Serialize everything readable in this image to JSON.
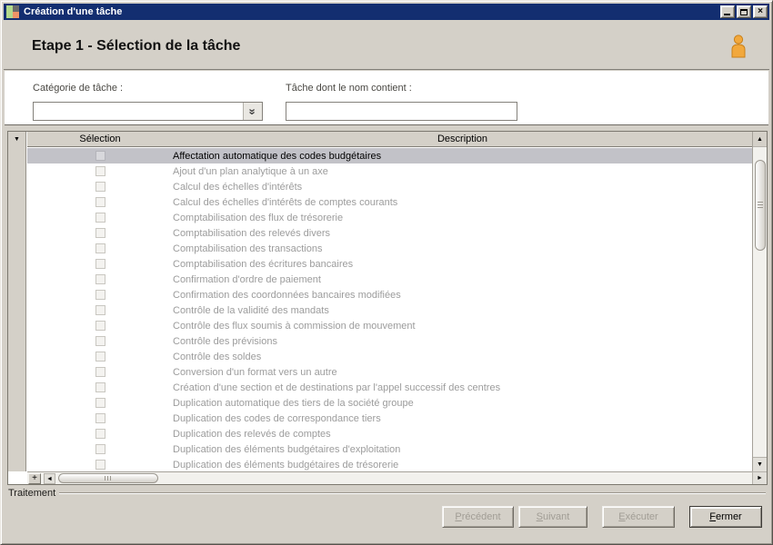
{
  "window": {
    "title": "Création d'une tâche",
    "controls": [
      {
        "name": "minimize"
      },
      {
        "name": "maximize"
      },
      {
        "name": "close"
      }
    ]
  },
  "header": {
    "step_title": "Etape 1 - Sélection de la tâche"
  },
  "form": {
    "category": {
      "label": "Catégorie de tâche :",
      "value": ""
    },
    "task_filter": {
      "label": "Tâche dont le nom contient :",
      "value": "",
      "placeholder": ""
    }
  },
  "table": {
    "columns": [
      "Sélection",
      "Description"
    ],
    "rows": [
      {
        "description": "Affectation automatique des codes budgétaires",
        "checked": false,
        "selected": true
      },
      {
        "description": "Ajout d'un plan analytique à un axe",
        "checked": false,
        "selected": false
      },
      {
        "description": "Calcul des échelles d'intérêts",
        "checked": false,
        "selected": false
      },
      {
        "description": "Calcul des échelles d'intérêts de comptes courants",
        "checked": false,
        "selected": false
      },
      {
        "description": "Comptabilisation des flux de trésorerie",
        "checked": false,
        "selected": false
      },
      {
        "description": "Comptabilisation des relevés divers",
        "checked": false,
        "selected": false
      },
      {
        "description": "Comptabilisation des transactions",
        "checked": false,
        "selected": false
      },
      {
        "description": "Comptabilisation des écritures bancaires",
        "checked": false,
        "selected": false
      },
      {
        "description": "Confirmation d'ordre de paiement",
        "checked": false,
        "selected": false
      },
      {
        "description": "Confirmation des coordonnées bancaires modifiées",
        "checked": false,
        "selected": false
      },
      {
        "description": "Contrôle de la validité des mandats",
        "checked": false,
        "selected": false
      },
      {
        "description": "Contrôle des flux soumis à commission de mouvement",
        "checked": false,
        "selected": false
      },
      {
        "description": "Contrôle des prévisions",
        "checked": false,
        "selected": false
      },
      {
        "description": "Contrôle des soldes",
        "checked": false,
        "selected": false
      },
      {
        "description": "Conversion d'un format vers un autre",
        "checked": false,
        "selected": false
      },
      {
        "description": "Création d'une section et de destinations par l'appel successif des centres",
        "checked": false,
        "selected": false
      },
      {
        "description": "Duplication automatique des tiers de la société groupe",
        "checked": false,
        "selected": false
      },
      {
        "description": "Duplication des codes de correspondance tiers",
        "checked": false,
        "selected": false
      },
      {
        "description": "Duplication des relevés de comptes",
        "checked": false,
        "selected": false
      },
      {
        "description": "Duplication des éléments budgétaires d'exploitation",
        "checked": false,
        "selected": false
      },
      {
        "description": "Duplication des éléments budgétaires de trésorerie",
        "checked": false,
        "selected": false
      }
    ]
  },
  "status": {
    "group_label": "Traitement"
  },
  "buttons": [
    {
      "label": "Précédent",
      "enabled": false
    },
    {
      "label": "Suivant",
      "enabled": false
    },
    {
      "label": "Exécuter",
      "enabled": false
    },
    {
      "label": "Fermer",
      "enabled": true
    }
  ],
  "icons": {
    "combo_chevron": "»",
    "down_triangle": "▼",
    "up_triangle": "▲",
    "left_triangle": "◄",
    "right_triangle": "►",
    "plus": "+",
    "close_glyph": "×"
  },
  "colors": {
    "titlebar": "#132e70",
    "chrome": "#d4d0c8",
    "selected_row": "#c2c2c8",
    "row_text": "#9c9c9c",
    "person_icon_fill": "#f2a83c",
    "person_icon_stroke": "#c9801a"
  }
}
